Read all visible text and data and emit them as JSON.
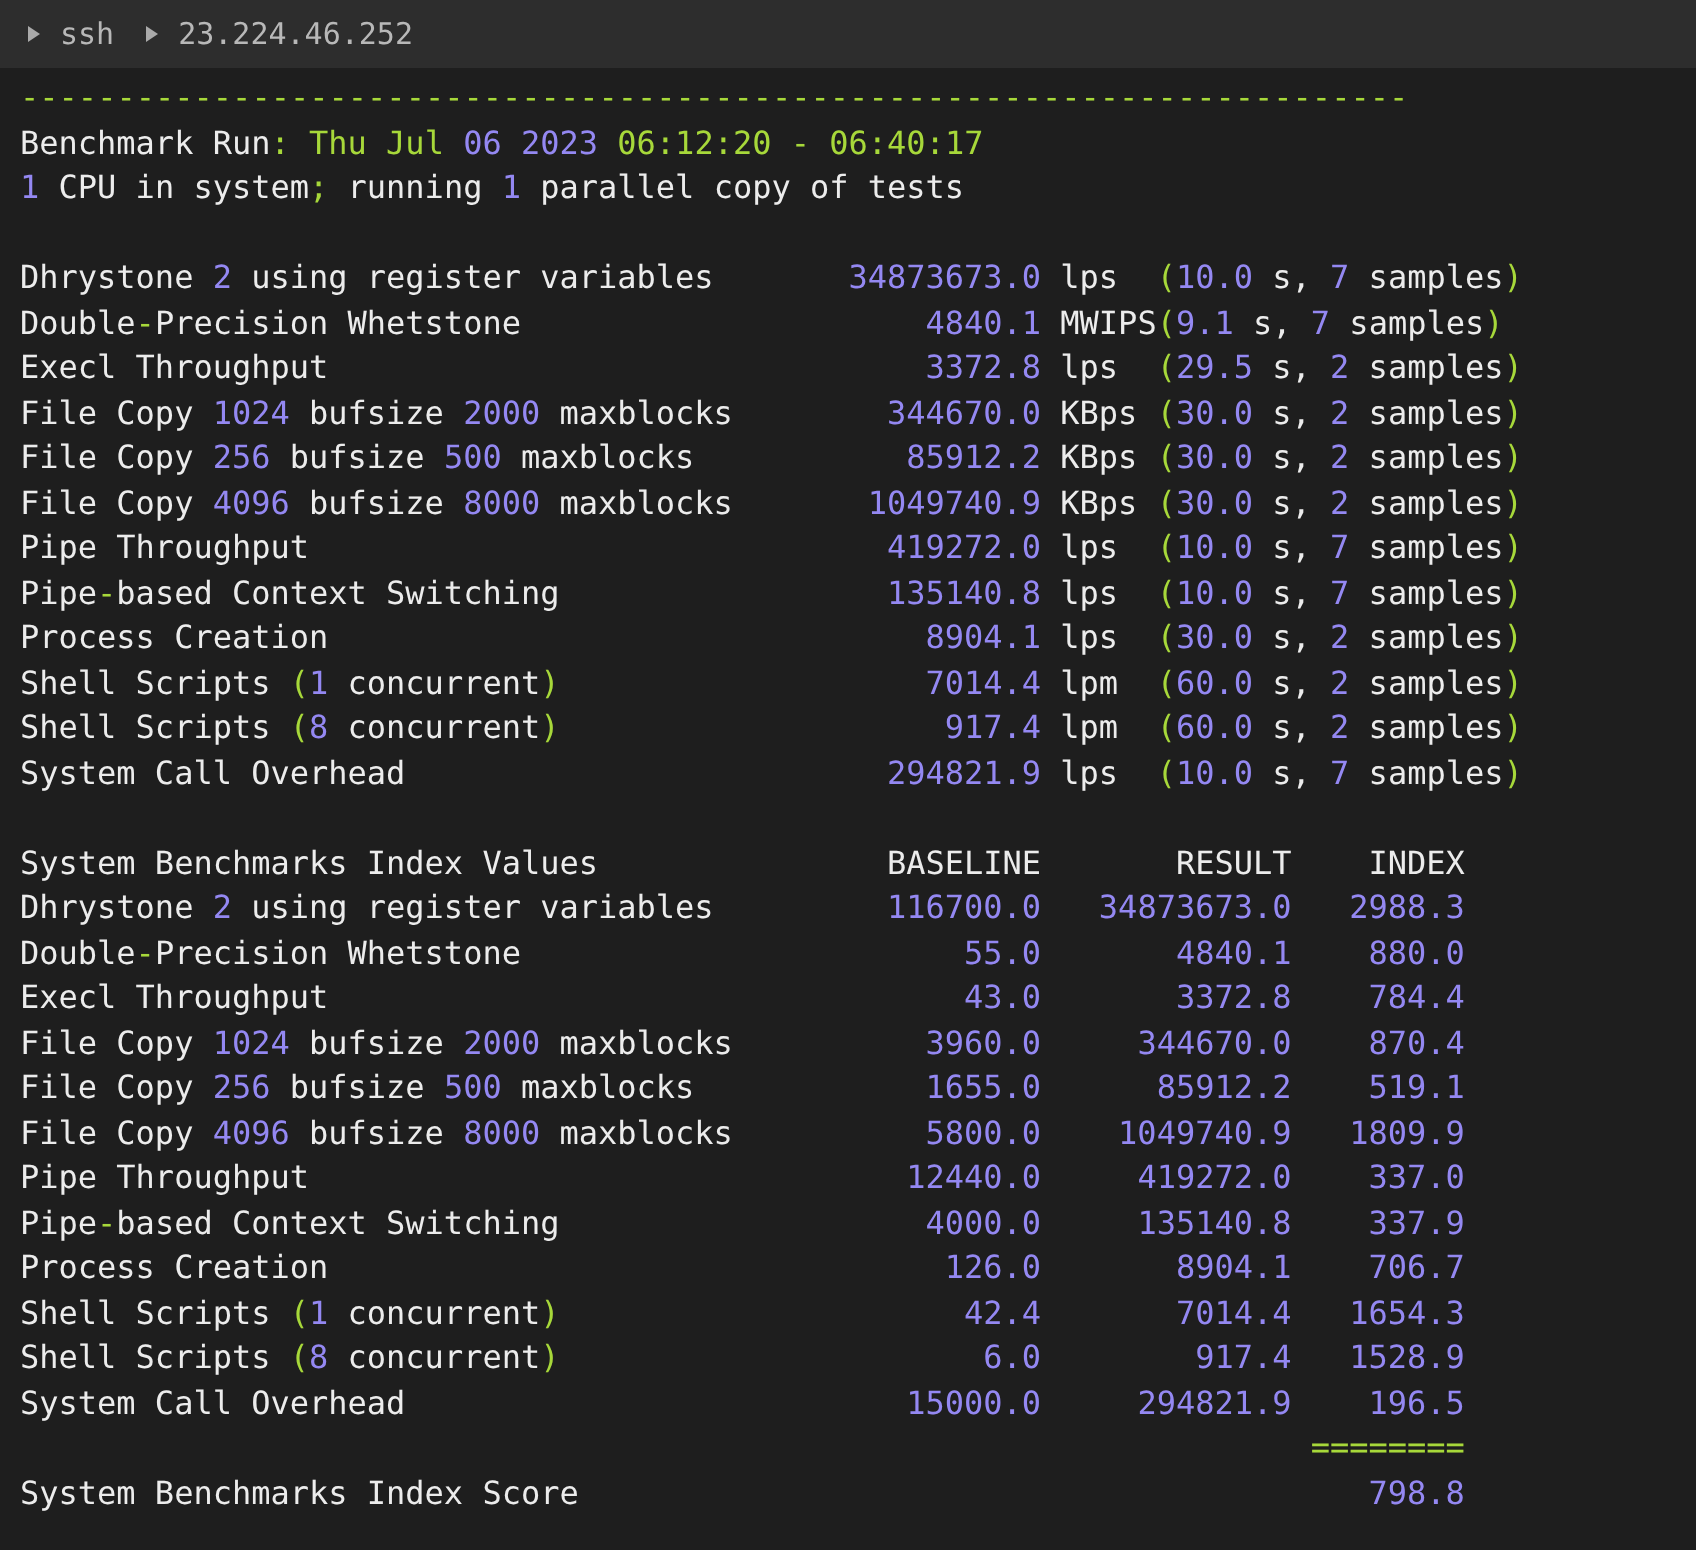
{
  "top_bar": {
    "path": [
      "ssh",
      "23.224.46.252"
    ]
  },
  "header": {
    "separator": "------------------------------------------------------------------------",
    "run": {
      "label": "Benchmark Run:",
      "date": "Thu Jul 06 2023 06:12:20 - 06:40:17"
    },
    "cpu_line": "1 CPU in system; running 1 parallel copy of tests"
  },
  "results": [
    {
      "name": "Dhrystone 2 using register variables",
      "value": "34873673.0",
      "unit": "lps",
      "detail": "(10.0 s, 7 samples)"
    },
    {
      "name": "Double-Precision Whetstone",
      "value": "4840.1",
      "unit": "MWIPS",
      "detail": "(9.1 s, 7 samples)"
    },
    {
      "name": "Execl Throughput",
      "value": "3372.8",
      "unit": "lps",
      "detail": "(29.5 s, 2 samples)"
    },
    {
      "name": "File Copy 1024 bufsize 2000 maxblocks",
      "value": "344670.0",
      "unit": "KBps",
      "detail": "(30.0 s, 2 samples)"
    },
    {
      "name": "File Copy 256 bufsize 500 maxblocks",
      "value": "85912.2",
      "unit": "KBps",
      "detail": "(30.0 s, 2 samples)"
    },
    {
      "name": "File Copy 4096 bufsize 8000 maxblocks",
      "value": "1049740.9",
      "unit": "KBps",
      "detail": "(30.0 s, 2 samples)"
    },
    {
      "name": "Pipe Throughput",
      "value": "419272.0",
      "unit": "lps",
      "detail": "(10.0 s, 7 samples)"
    },
    {
      "name": "Pipe-based Context Switching",
      "value": "135140.8",
      "unit": "lps",
      "detail": "(10.0 s, 7 samples)"
    },
    {
      "name": "Process Creation",
      "value": "8904.1",
      "unit": "lps",
      "detail": "(30.0 s, 2 samples)"
    },
    {
      "name": "Shell Scripts (1 concurrent)",
      "value": "7014.4",
      "unit": "lpm",
      "detail": "(60.0 s, 2 samples)"
    },
    {
      "name": "Shell Scripts (8 concurrent)",
      "value": "917.4",
      "unit": "lpm",
      "detail": "(60.0 s, 2 samples)"
    },
    {
      "name": "System Call Overhead",
      "value": "294821.9",
      "unit": "lps",
      "detail": "(10.0 s, 7 samples)"
    }
  ],
  "index": {
    "columns": [
      "System Benchmarks Index Values",
      "BASELINE",
      "RESULT",
      "INDEX"
    ],
    "rows": [
      {
        "name": "Dhrystone 2 using register variables",
        "baseline": "116700.0",
        "result": "34873673.0",
        "index": "2988.3"
      },
      {
        "name": "Double-Precision Whetstone",
        "baseline": "55.0",
        "result": "4840.1",
        "index": "880.0"
      },
      {
        "name": "Execl Throughput",
        "baseline": "43.0",
        "result": "3372.8",
        "index": "784.4"
      },
      {
        "name": "File Copy 1024 bufsize 2000 maxblocks",
        "baseline": "3960.0",
        "result": "344670.0",
        "index": "870.4"
      },
      {
        "name": "File Copy 256 bufsize 500 maxblocks",
        "baseline": "1655.0",
        "result": "85912.2",
        "index": "519.1"
      },
      {
        "name": "File Copy 4096 bufsize 8000 maxblocks",
        "baseline": "5800.0",
        "result": "1049740.9",
        "index": "1809.9"
      },
      {
        "name": "Pipe Throughput",
        "baseline": "12440.0",
        "result": "419272.0",
        "index": "337.0"
      },
      {
        "name": "Pipe-based Context Switching",
        "baseline": "4000.0",
        "result": "135140.8",
        "index": "337.9"
      },
      {
        "name": "Process Creation",
        "baseline": "126.0",
        "result": "8904.1",
        "index": "706.7"
      },
      {
        "name": "Shell Scripts (1 concurrent)",
        "baseline": "42.4",
        "result": "7014.4",
        "index": "1654.3"
      },
      {
        "name": "Shell Scripts (8 concurrent)",
        "baseline": "6.0",
        "result": "917.4",
        "index": "1528.9"
      },
      {
        "name": "System Call Overhead",
        "baseline": "15000.0",
        "result": "294821.9",
        "index": "196.5"
      }
    ],
    "underline": "========",
    "score_label": "System Benchmarks Index Score",
    "score": "798.8"
  }
}
